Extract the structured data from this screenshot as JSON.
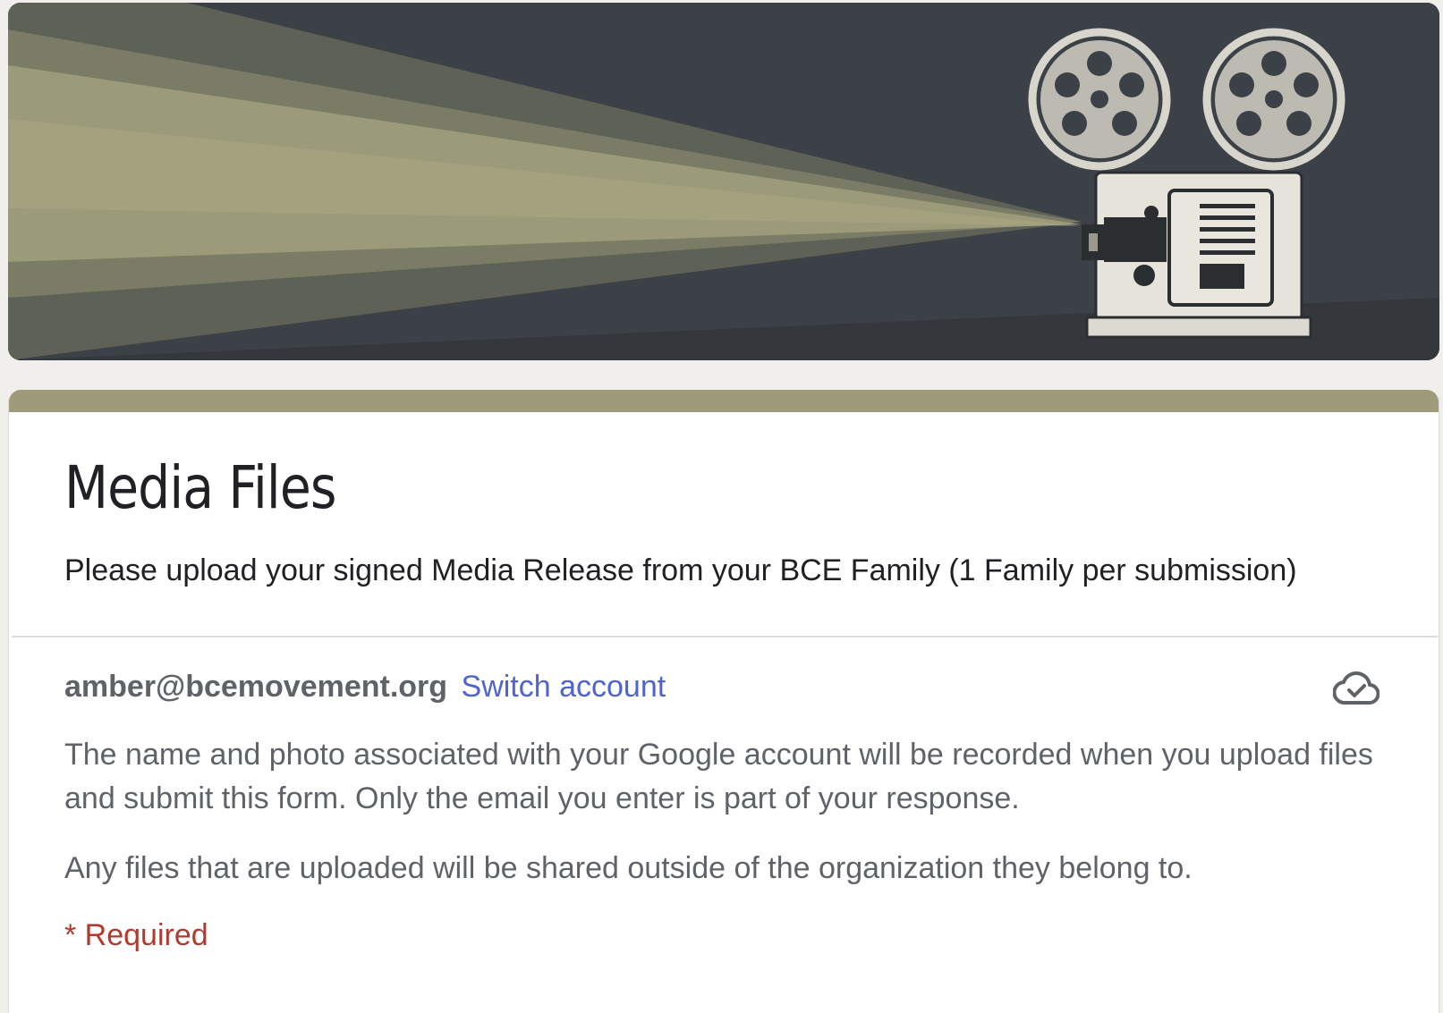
{
  "banner": {
    "colors": {
      "background": "#3c4147",
      "beam_light": "#9c9b79",
      "beam_mid": "#7e7f68",
      "beam_dark": "#5b5f55",
      "projector_body": "#e6e4da"
    },
    "icon": "film-projector-illustration"
  },
  "form": {
    "accent_color": "#9d9b79",
    "title": "Media Files",
    "description": "Please upload your signed Media Release from your BCE Family (1 Family per submission)"
  },
  "account": {
    "email": "amber@bcemovement.org",
    "switch_label": "Switch account",
    "status_icon": "cloud-done-icon"
  },
  "notices": {
    "recorded": "The name and photo associated with your Google account will be recorded when you upload files and submit this form. Only the email you enter is part of your response.",
    "shared": "Any files that are uploaded will be shared outside of the organization they belong to."
  },
  "required_note": "* Required"
}
